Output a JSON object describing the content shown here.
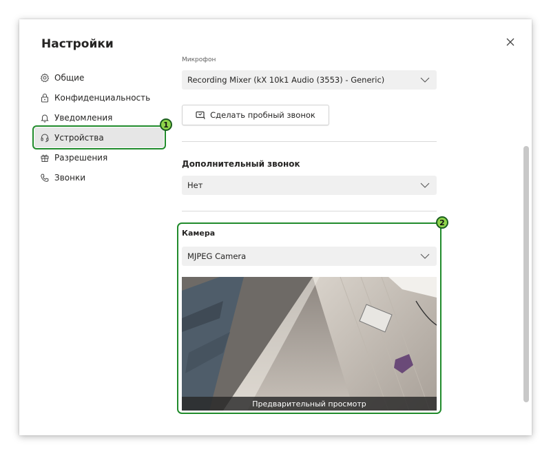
{
  "dialog": {
    "title": "Настройки"
  },
  "nav": {
    "items": [
      {
        "label": "Общие",
        "icon": "gear-icon"
      },
      {
        "label": "Конфиденциальность",
        "icon": "lock-icon"
      },
      {
        "label": "Уведомления",
        "icon": "bell-icon"
      },
      {
        "label": "Устройства",
        "icon": "headset-icon",
        "active": true
      },
      {
        "label": "Разрешения",
        "icon": "gift-icon"
      },
      {
        "label": "Звонки",
        "icon": "phone-icon"
      }
    ]
  },
  "devices": {
    "microphone_label": "Микрофон",
    "microphone_value": "Recording Mixer (kX 10k1 Audio (3553) - Generic)",
    "test_call_label": "Сделать пробный звонок",
    "secondary_ringer_title": "Дополнительный звонок",
    "secondary_ringer_value": "Нет",
    "camera_title": "Камера",
    "camera_value": "MJPEG Camera",
    "preview_label": "Предварительный просмотр"
  },
  "annotations": {
    "badge1": "1",
    "badge2": "2"
  },
  "colors": {
    "highlight": "#1f8a2a",
    "badge_fill": "#8fd44a",
    "active_nav": "#e6e6e6"
  }
}
